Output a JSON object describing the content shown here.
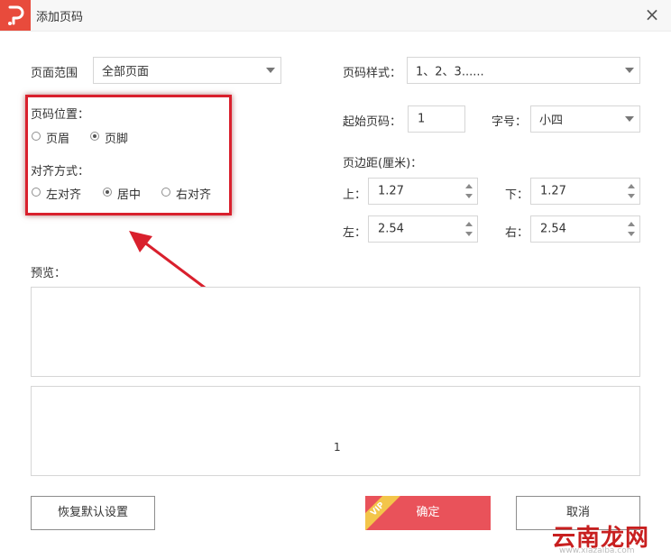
{
  "dialog": {
    "title": "添加页码",
    "close_glyph": "×",
    "logo_icon": "app-logo-icon",
    "accent_color": "#e84b3c"
  },
  "page_range": {
    "label": "页面范围",
    "value": "全部页面"
  },
  "page_style": {
    "label": "页码样式：",
    "value": "1、2、3......"
  },
  "position": {
    "label": "页码位置：",
    "options": [
      {
        "label": "页眉",
        "selected": false
      },
      {
        "label": "页脚",
        "selected": true
      }
    ]
  },
  "alignment": {
    "label": "对齐方式：",
    "options": [
      {
        "label": "左对齐",
        "selected": false
      },
      {
        "label": "居中",
        "selected": true
      },
      {
        "label": "右对齐",
        "selected": false
      }
    ]
  },
  "start_page": {
    "label": "起始页码：",
    "value": "1"
  },
  "font_size": {
    "label": "字号：",
    "value": "小四"
  },
  "margins": {
    "label": "页边距(厘米)：",
    "top": {
      "label": "上：",
      "value": "1.27"
    },
    "bottom": {
      "label": "下：",
      "value": "1.27"
    },
    "left": {
      "label": "左：",
      "value": "2.54"
    },
    "right": {
      "label": "右：",
      "value": "2.54"
    }
  },
  "preview": {
    "label": "预览：",
    "page_number": "1"
  },
  "buttons": {
    "restore_defaults": "恢复默认设置",
    "confirm": "确定",
    "confirm_badge": "VIP",
    "cancel": "取消"
  },
  "watermark": {
    "text": "云南龙网",
    "sub": "www.xiazaiba.com"
  }
}
